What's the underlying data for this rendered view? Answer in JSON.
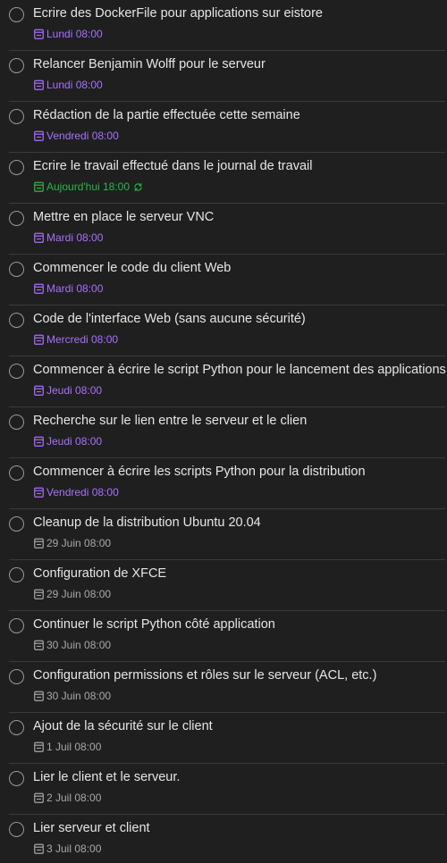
{
  "colors": {
    "background": "#1f1f1f",
    "title": "#e6e6e6",
    "upcoming": "#a970ff",
    "today": "#25b84c",
    "later": "#a8a8a8",
    "divider": "#3a3a3a"
  },
  "tasks": [
    {
      "title": "Ecrire des DockerFile pour applications sur eistore",
      "due": "Lundi 08:00",
      "due_color": "purple",
      "due_icon": "calendar-icon",
      "recurring": false
    },
    {
      "title": "Relancer Benjamin Wolff pour le serveur",
      "due": "Lundi 08:00",
      "due_color": "purple",
      "due_icon": "calendar-icon",
      "recurring": false
    },
    {
      "title": "Rédaction de la partie effectuée cette semaine",
      "due": "Vendredi 08:00",
      "due_color": "purple",
      "due_icon": "calendar-icon",
      "recurring": false
    },
    {
      "title": "Ecrire le travail effectué dans le journal de travail",
      "due": "Aujourd'hui 18:00",
      "due_color": "green",
      "due_icon": "calendar-icon",
      "recurring": true,
      "recurring_icon": "repeat-icon"
    },
    {
      "title": "Mettre en place le serveur VNC",
      "due": "Mardi 08:00",
      "due_color": "purple",
      "due_icon": "calendar-icon",
      "recurring": false
    },
    {
      "title": "Commencer le code du client Web",
      "due": "Mardi 08:00",
      "due_color": "purple",
      "due_icon": "calendar-icon",
      "recurring": false
    },
    {
      "title": "Code de l'interface Web (sans aucune sécurité)",
      "due": "Mercredi 08:00",
      "due_color": "purple",
      "due_icon": "calendar-icon",
      "recurring": false
    },
    {
      "title": "Commencer à écrire le script Python pour le lancement des applications",
      "due": "Jeudi 08:00",
      "due_color": "purple",
      "due_icon": "calendar-icon",
      "recurring": false
    },
    {
      "title": "Recherche sur le lien entre le serveur et le clien",
      "due": "Jeudi 08:00",
      "due_color": "purple",
      "due_icon": "calendar-icon",
      "recurring": false
    },
    {
      "title": "Commencer à écrire les scripts Python pour la distribution",
      "due": "Vendredi 08:00",
      "due_color": "purple",
      "due_icon": "calendar-icon",
      "recurring": false
    },
    {
      "title": "Cleanup de la distribution Ubuntu 20.04",
      "due": "29 Juin 08:00",
      "due_color": "grey",
      "due_icon": "calendar-icon",
      "recurring": false
    },
    {
      "title": "Configuration de XFCE",
      "due": "29 Juin 08:00",
      "due_color": "grey",
      "due_icon": "calendar-icon",
      "recurring": false
    },
    {
      "title": "Continuer le script Python côté application",
      "due": "30 Juin 08:00",
      "due_color": "grey",
      "due_icon": "calendar-icon",
      "recurring": false
    },
    {
      "title": "Configuration permissions et rôles sur le serveur (ACL, etc.)",
      "due": "30 Juin 08:00",
      "due_color": "grey",
      "due_icon": "calendar-icon",
      "recurring": false
    },
    {
      "title": "Ajout de la sécurité sur le client",
      "due": "1 Juil 08:00",
      "due_color": "grey",
      "due_icon": "calendar-icon",
      "recurring": false
    },
    {
      "title": "Lier le client et le serveur.",
      "due": "2 Juil 08:00",
      "due_color": "grey",
      "due_icon": "calendar-icon",
      "recurring": false
    },
    {
      "title": "Lier serveur et client",
      "due": "3 Juil 08:00",
      "due_color": "grey",
      "due_icon": "calendar-icon",
      "recurring": false
    }
  ]
}
